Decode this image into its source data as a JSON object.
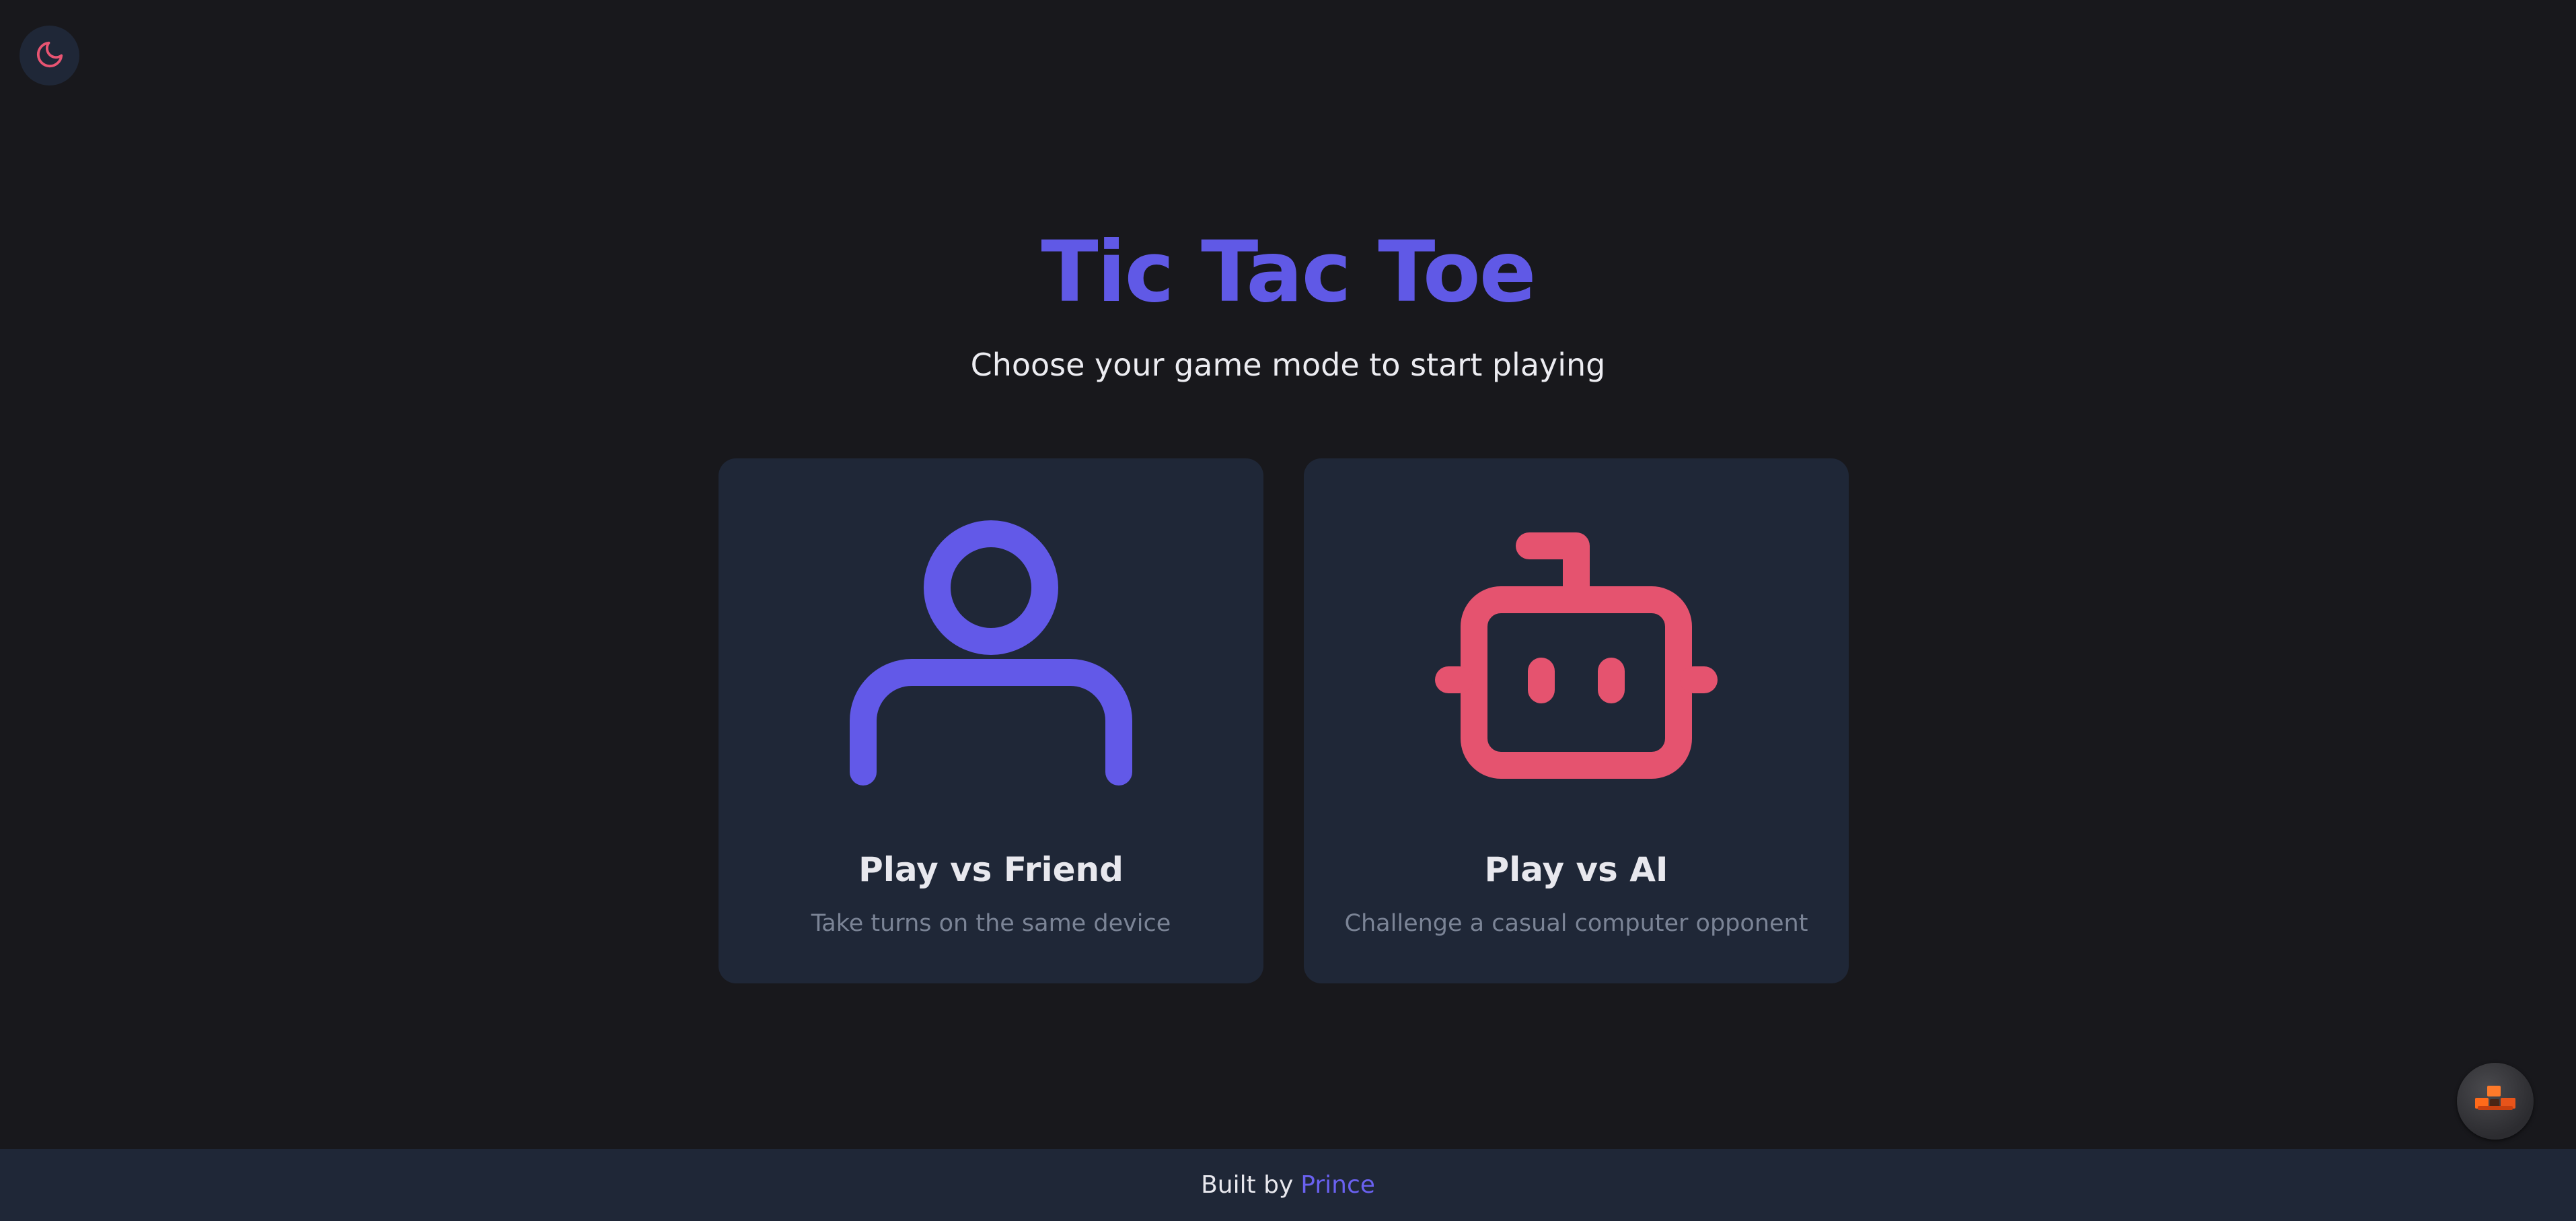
{
  "theme_toggle": {
    "icon": "moon-icon",
    "icon_color": "#e85472"
  },
  "header": {
    "title": "Tic Tac Toe",
    "subtitle": "Choose your game mode to start playing"
  },
  "modes": [
    {
      "title": "Play vs Friend",
      "description": "Take turns on the same device",
      "icon": "user-icon",
      "icon_color": "#6259e8"
    },
    {
      "title": "Play vs AI",
      "description": "Challenge a casual computer opponent",
      "icon": "robot-icon",
      "icon_color": "#e5536f"
    }
  ],
  "floating_button": {
    "icon": "blocks-logo-icon"
  },
  "footer": {
    "prefix": "Built by",
    "author": "Prince"
  },
  "colors": {
    "background": "#18181c",
    "card": "#1f2737",
    "accent": "#6059e6",
    "ai_accent": "#e5536f"
  }
}
